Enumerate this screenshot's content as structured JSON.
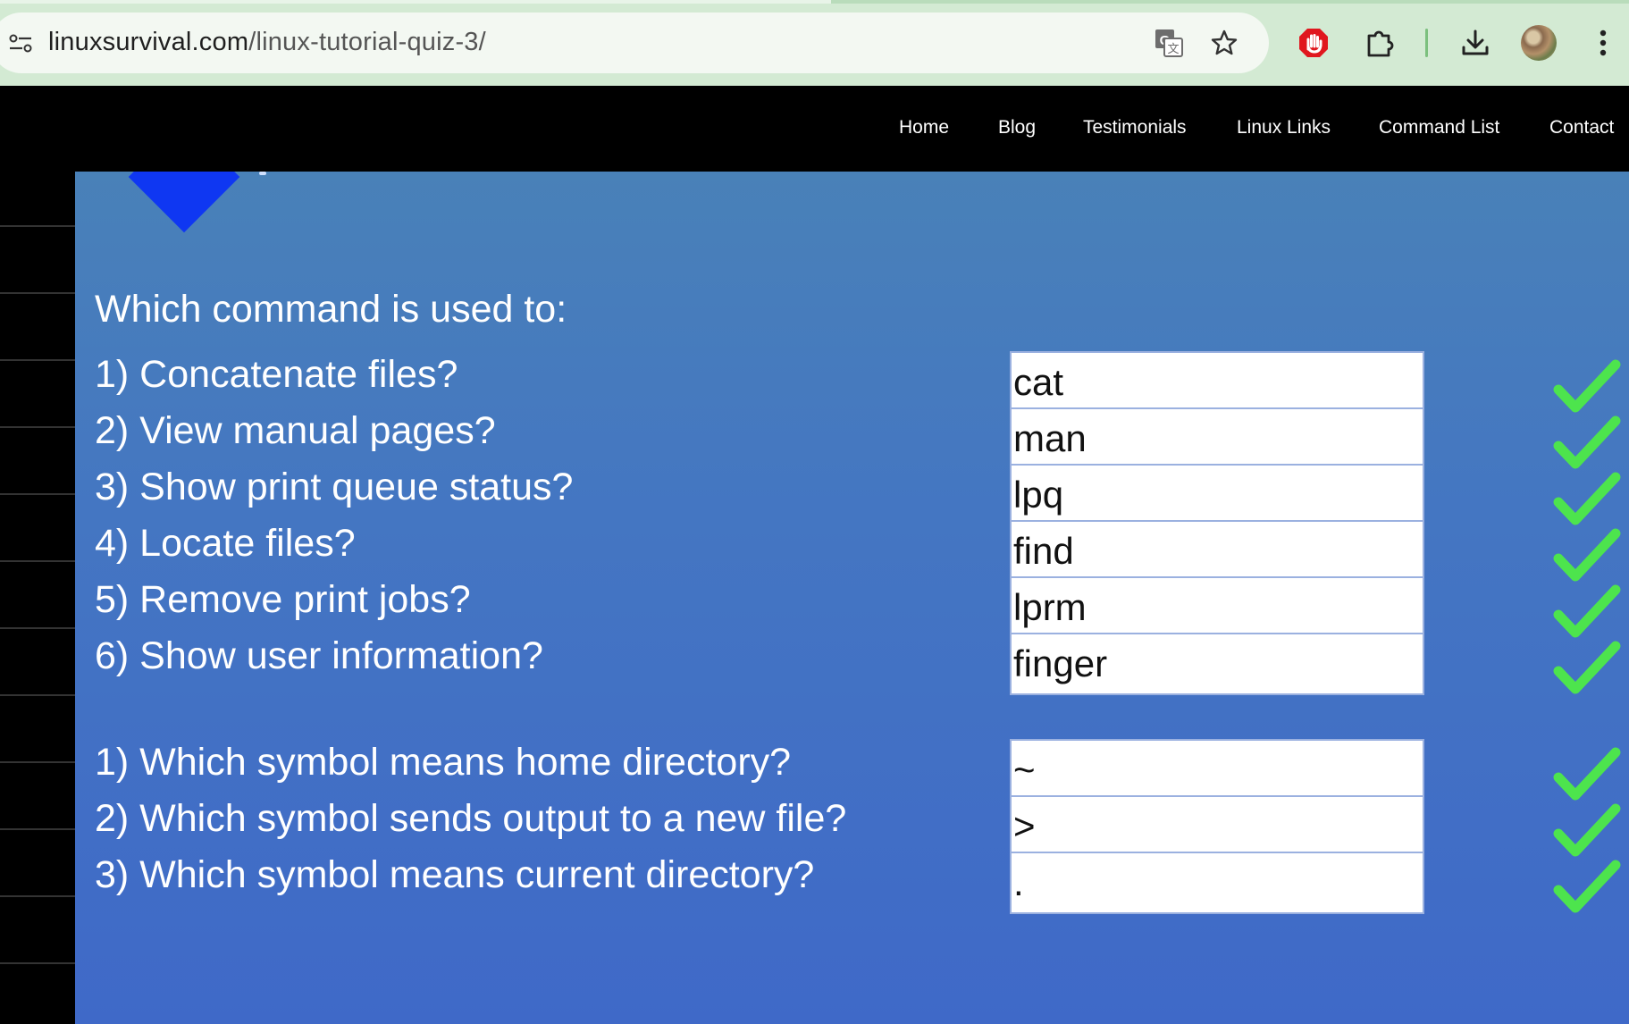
{
  "browser": {
    "url_domain": "linuxsurvival.com",
    "url_path": "/linux-tutorial-quiz-3/",
    "icons": [
      "site-info-icon",
      "translate-icon",
      "bookmark-star-icon",
      "adblock-icon",
      "extensions-icon",
      "download-icon",
      "profile-avatar",
      "more-menu-icon"
    ]
  },
  "nav": {
    "items": [
      "Home",
      "Blog",
      "Testimonials",
      "Linux Links",
      "Command List",
      "Contact"
    ]
  },
  "quiz": {
    "heading": "Which command is used to:",
    "commands": [
      {
        "question": "1) Concatenate files?",
        "answer": "cat",
        "status": "correct"
      },
      {
        "question": "2) View manual pages?",
        "answer": "man",
        "status": "correct"
      },
      {
        "question": "3) Show print queue status?",
        "answer": "lpq",
        "status": "correct"
      },
      {
        "question": "4) Locate files?",
        "answer": "find",
        "status": "correct"
      },
      {
        "question": "5) Remove print jobs?",
        "answer": "lprm",
        "status": "correct"
      },
      {
        "question": "6) Show user information?",
        "answer": "finger",
        "status": "correct"
      }
    ],
    "symbols": [
      {
        "question": "1) Which symbol means home directory?",
        "answer": "~",
        "status": "correct"
      },
      {
        "question": "2) Which symbol sends output to a new file?",
        "answer": ">",
        "status": "correct"
      },
      {
        "question": "3) Which symbol means current directory?",
        "answer": ".",
        "status": "correct"
      }
    ]
  },
  "colors": {
    "panel_top": "#4981b8",
    "panel_bottom": "#3f69c8",
    "diamond": "#0f37f2",
    "check": "#4de44d",
    "nav_bg": "#000000",
    "chrome_bg": "#d3ead3"
  }
}
